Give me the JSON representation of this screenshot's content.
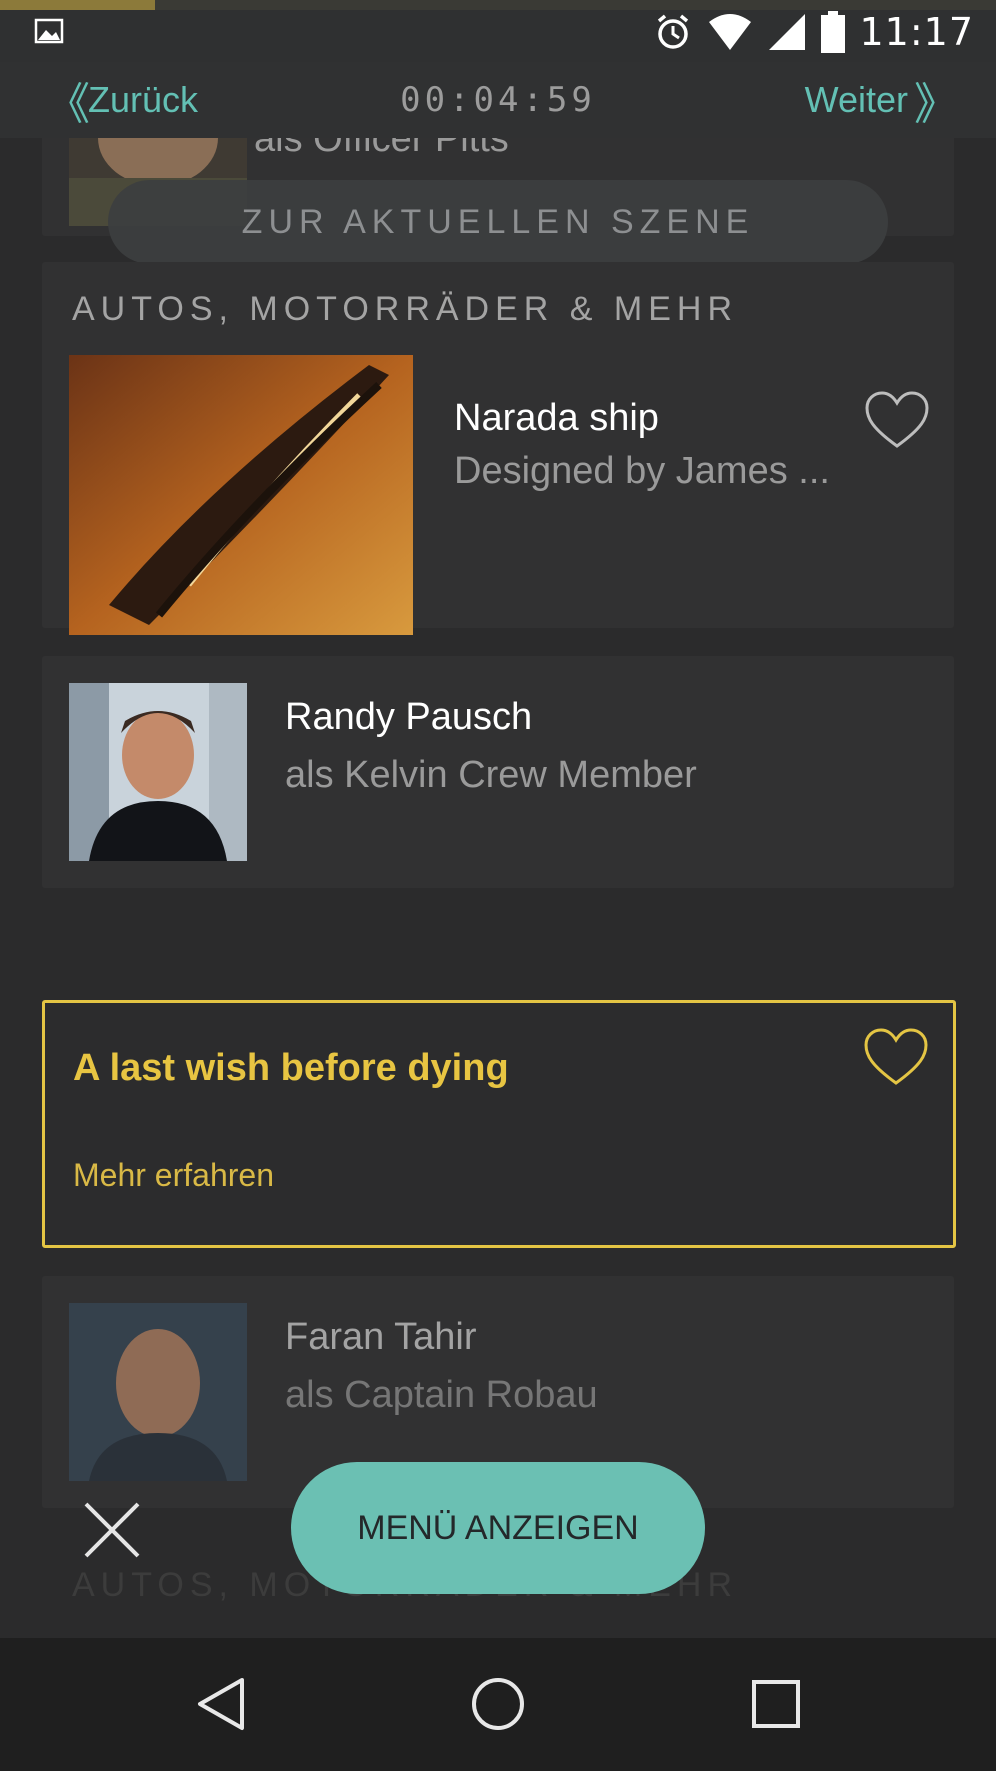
{
  "status_bar": {
    "time": "11:17",
    "icons": [
      "gallery-icon",
      "alarm-icon",
      "wifi-icon",
      "signal-icon",
      "battery-icon"
    ],
    "progress_fraction": 0.155
  },
  "nav": {
    "back_label": "Zurück",
    "next_label": "Weiter",
    "timer": "00:04:59"
  },
  "scene_button": {
    "label": "ZUR AKTUELLEN SZENE"
  },
  "cards": {
    "pitts_role": "als Officer Pitts",
    "section_vehicles": "AUTOS, MOTORRÄDER & MEHR",
    "narada": {
      "title": "Narada ship",
      "subtitle": "Designed by James ..."
    },
    "randy": {
      "title": "Randy Pausch",
      "subtitle": "als Kelvin Crew Member"
    },
    "highlight": {
      "title": "A last wish before dying",
      "link": "Mehr erfahren"
    },
    "faran": {
      "title": "Faran Tahir",
      "subtitle": "als Captain Robau"
    },
    "section_vehicles_faded": "AUTOS, MOTORRÄDER & MEHR"
  },
  "menu_button": {
    "label": "MENÜ ANZEIGEN"
  },
  "colors": {
    "accent_teal": "#63c0b4",
    "highlight_yellow": "#e4c544",
    "background": "#2b2b2c"
  }
}
